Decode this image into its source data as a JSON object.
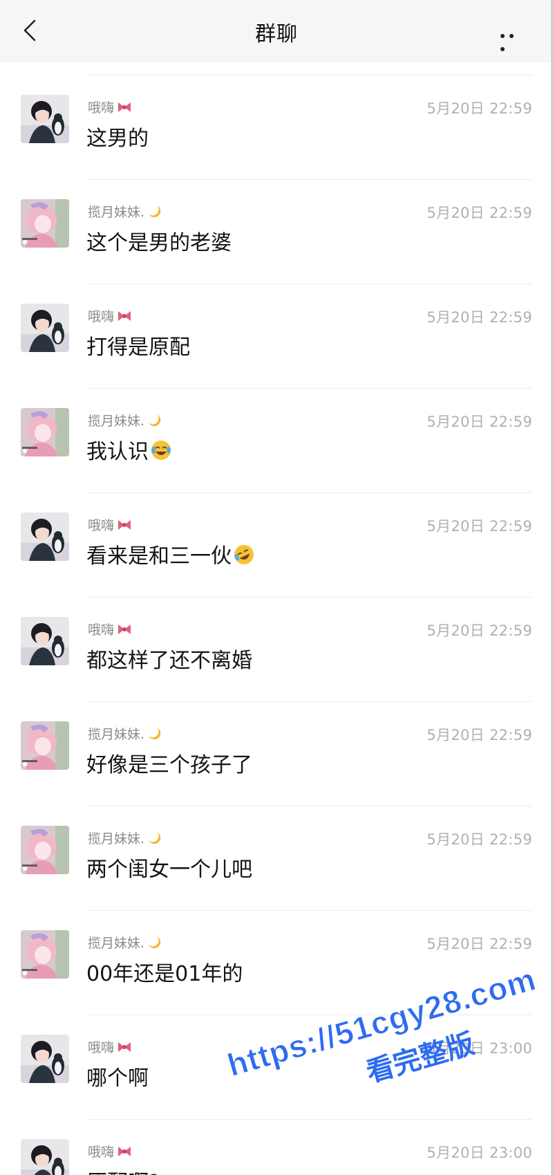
{
  "header": {
    "title": "群聊",
    "back_icon": "chevron-left-icon",
    "more_icon": "more-dots-icon"
  },
  "messages": [
    {
      "sender": "哦嗨",
      "badge": "bow-icon",
      "time": "5月20日 22:59",
      "text": "这男的",
      "avatar": "avatar-girl-penguin"
    },
    {
      "sender": "揽月妹妹.",
      "badge": "moon-icon",
      "time": "5月20日 22:59",
      "text": "这个是男的老婆",
      "avatar": "avatar-pink-anime"
    },
    {
      "sender": "哦嗨",
      "badge": "bow-icon",
      "time": "5月20日 22:59",
      "text": "打得是原配",
      "avatar": "avatar-girl-penguin"
    },
    {
      "sender": "揽月妹妹.",
      "badge": "moon-icon",
      "time": "5月20日 22:59",
      "text": "我认识",
      "emoji": "tears-of-joy-emoji",
      "avatar": "avatar-pink-anime"
    },
    {
      "sender": "哦嗨",
      "badge": "bow-icon",
      "time": "5月20日 22:59",
      "text": "看来是和三一伙",
      "emoji": "rolling-laughing-emoji",
      "avatar": "avatar-girl-penguin"
    },
    {
      "sender": "哦嗨",
      "badge": "bow-icon",
      "time": "5月20日 22:59",
      "text": "都这样了还不离婚",
      "avatar": "avatar-girl-penguin"
    },
    {
      "sender": "揽月妹妹.",
      "badge": "moon-icon",
      "time": "5月20日 22:59",
      "text": "好像是三个孩子了",
      "avatar": "avatar-pink-anime"
    },
    {
      "sender": "揽月妹妹.",
      "badge": "moon-icon",
      "time": "5月20日 22:59",
      "text": "两个闺女一个儿吧",
      "avatar": "avatar-pink-anime"
    },
    {
      "sender": "揽月妹妹.",
      "badge": "moon-icon",
      "time": "5月20日 22:59",
      "text": "00年还是01年的",
      "avatar": "avatar-pink-anime"
    },
    {
      "sender": "哦嗨",
      "badge": "bow-icon",
      "time": "5月20日 23:00",
      "text": "哪个啊",
      "avatar": "avatar-girl-penguin"
    },
    {
      "sender": "哦嗨",
      "badge": "bow-icon",
      "time": "5月20日 23:00",
      "text": "原配啊?",
      "avatar": "avatar-girl-penguin"
    }
  ],
  "watermark": {
    "url": "https://51cgy28.com",
    "subtitle": "看完整版"
  }
}
